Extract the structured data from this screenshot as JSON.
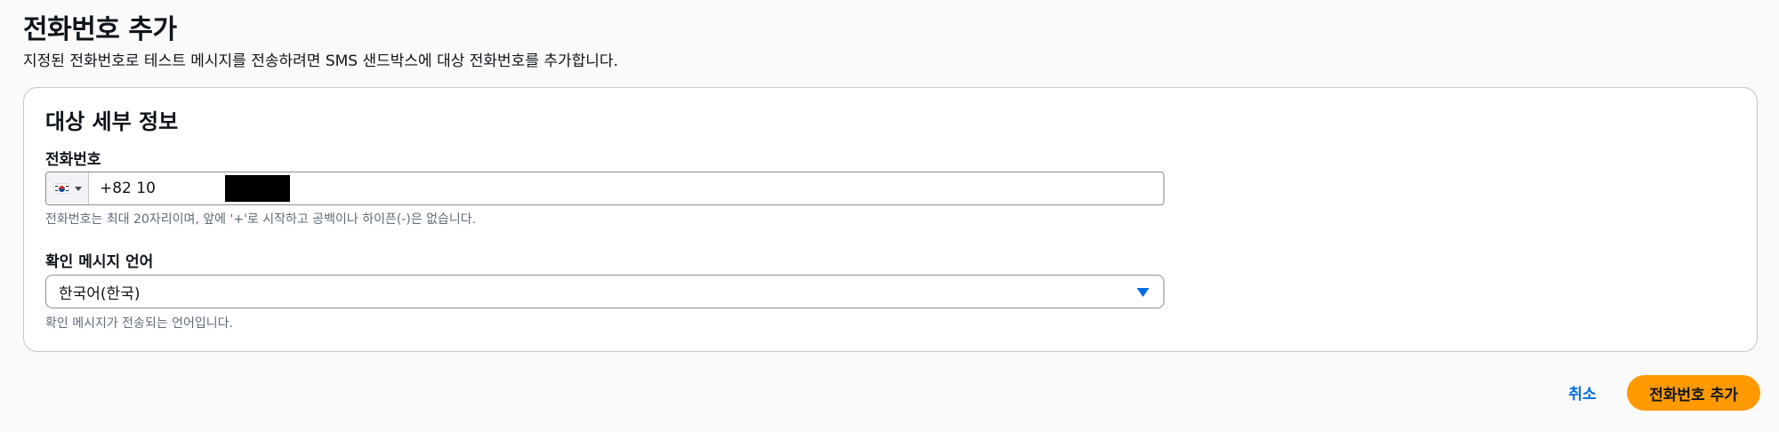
{
  "page": {
    "title": "전화번호 추가",
    "description": "지정된 전화번호로 테스트 메시지를 전송하려면 SMS 샌드박스에 대상 전화번호를 추가합니다."
  },
  "destination": {
    "header": "대상 세부 정보",
    "phone": {
      "label": "전화번호",
      "country_flag": "kr-flag-icon",
      "value_prefix": "+82 10",
      "constraint": "전화번호는 최대 20자리이며, 앞에 '+'로 시작하고 공백이나 하이픈(-)은 없습니다."
    },
    "language": {
      "label": "확인 메시지 언어",
      "selected": "한국어(한국)",
      "constraint": "확인 메시지가 전송되는 언어입니다."
    }
  },
  "actions": {
    "cancel_label": "취소",
    "submit_label": "전화번호 추가"
  },
  "colors": {
    "primary_button": "#ff9900",
    "link": "#006ce0",
    "border": "#8c8c94"
  }
}
